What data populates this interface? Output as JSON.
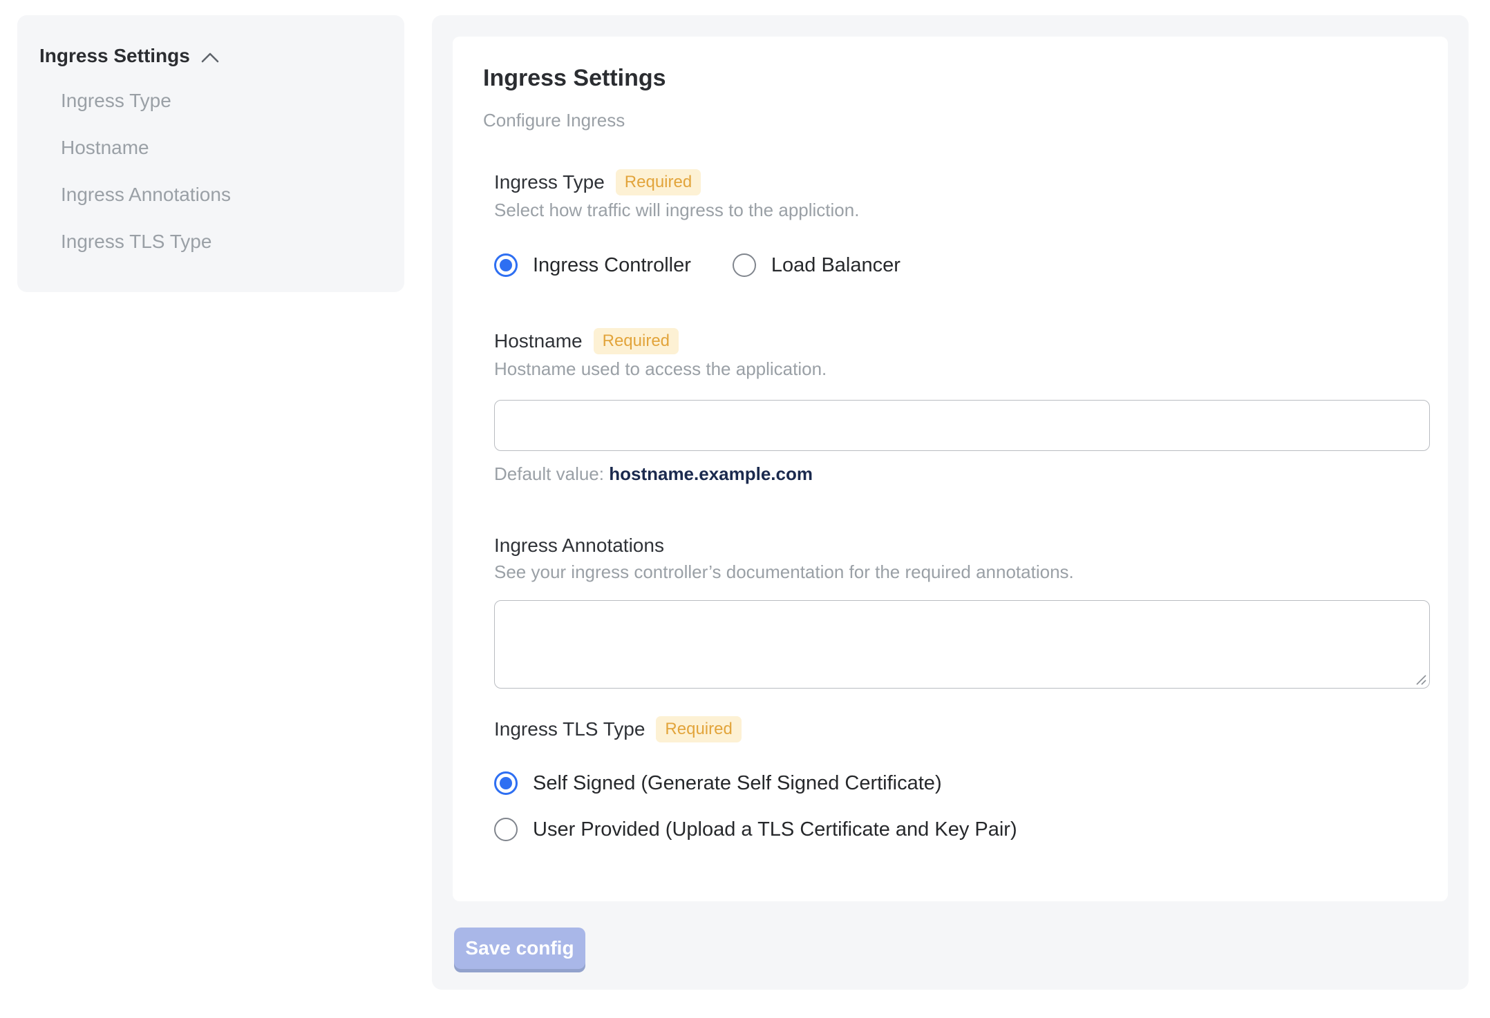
{
  "sidebar": {
    "header": "Ingress Settings",
    "chevron_icon": "chevron-up-icon",
    "items": [
      {
        "label": "Ingress Type"
      },
      {
        "label": "Hostname"
      },
      {
        "label": "Ingress Annotations"
      },
      {
        "label": "Ingress TLS Type"
      }
    ]
  },
  "form": {
    "title": "Ingress Settings",
    "subtitle": "Configure Ingress",
    "required_label": "Required",
    "fields": {
      "ingress_type": {
        "label": "Ingress Type",
        "required": true,
        "description": "Select how traffic will ingress to the appliction.",
        "options": [
          {
            "label": "Ingress Controller",
            "selected": true
          },
          {
            "label": "Load Balancer",
            "selected": false
          }
        ]
      },
      "hostname": {
        "label": "Hostname",
        "required": true,
        "description": "Hostname used to access the application.",
        "value": "",
        "default_hint_prefix": "Default value: ",
        "default_value": "hostname.example.com"
      },
      "ingress_annotations": {
        "label": "Ingress Annotations",
        "required": false,
        "description": "See your ingress controller’s documentation for the required annotations.",
        "value": ""
      },
      "ingress_tls_type": {
        "label": "Ingress TLS Type",
        "required": true,
        "options": [
          {
            "label": "Self Signed (Generate Self Signed Certificate)",
            "selected": true
          },
          {
            "label": "User Provided (Upload a TLS Certificate and Key Pair)",
            "selected": false
          }
        ]
      }
    },
    "save_button_label": "Save config"
  },
  "colors": {
    "accent_blue": "#2e6ff2",
    "required_text": "#e2a43b",
    "required_bg": "#fdf1d4",
    "panel_bg": "#f5f6f8",
    "save_button_bg": "#a9b7e8",
    "default_value_text": "#1b2a4e"
  }
}
